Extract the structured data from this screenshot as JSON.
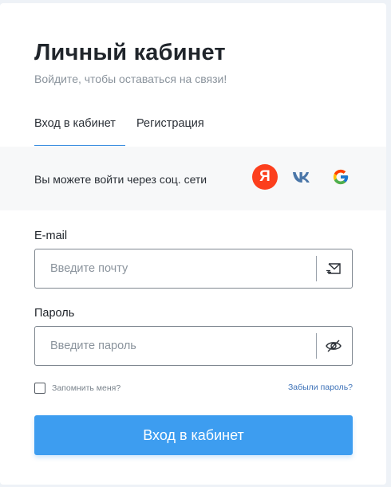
{
  "header": {
    "title": "Личный кабинет",
    "subtitle": "Войдите, чтобы оставаться на связи!"
  },
  "tabs": [
    {
      "label": "Вход в кабинет",
      "active": true
    },
    {
      "label": "Регистрация",
      "active": false
    }
  ],
  "social": {
    "text": "Вы можете войти через соц. сети",
    "providers": [
      {
        "name": "yandex",
        "icon": "yandex-icon",
        "glyph": "Я",
        "color": "#fc3f1d"
      },
      {
        "name": "vk",
        "icon": "vk-icon",
        "color": "#4a76a8"
      },
      {
        "name": "google",
        "icon": "google-icon"
      }
    ]
  },
  "form": {
    "email": {
      "label": "E-mail",
      "placeholder": "Введите почту",
      "value": "",
      "icon": "mail-icon"
    },
    "password": {
      "label": "Пароль",
      "placeholder": "Введите пароль",
      "value": "",
      "icon": "eye-off-icon"
    },
    "remember_label": "Запомнить меня?",
    "remember_checked": false,
    "forgot_label": "Забыли пароль?",
    "submit_label": "Вход в кабинет"
  },
  "colors": {
    "accent": "#3d9df0",
    "link": "#3d72b8",
    "tab_underline": "#3d8fe0"
  }
}
